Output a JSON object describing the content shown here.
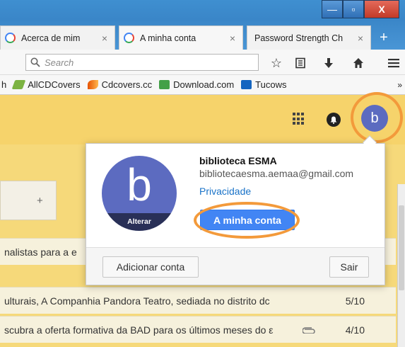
{
  "browser": {
    "tabs": [
      {
        "label": "Acerca de mim",
        "close": "×"
      },
      {
        "label": "A minha conta",
        "close": "×"
      },
      {
        "label": "Password Strength Ch",
        "close": "×"
      }
    ],
    "new_tab": "+",
    "window_buttons": {
      "minimize": "—",
      "maximize": "▫",
      "close": "X"
    },
    "search": {
      "placeholder": "Search"
    },
    "bookmarks": [
      {
        "label": "h"
      },
      {
        "label": "AllCDCovers",
        "color": "#7cb342"
      },
      {
        "label": "Cdcovers.cc",
        "color": "#e65100"
      },
      {
        "label": "Download.com",
        "color": "#2e7d32"
      },
      {
        "label": "Tucows",
        "color": "#1565c0"
      }
    ],
    "bookmarks_overflow": "»"
  },
  "gmail": {
    "avatar_letter": "b",
    "emails": [
      {
        "text": "nalistas para a e",
        "date": ""
      },
      {
        "text": "ulturais, A Companhia Pandora Teatro, sediada no distrito dc",
        "date": "5/10"
      },
      {
        "text": "scubra a oferta formativa da BAD para os últimos meses do ε",
        "date": "4/10",
        "attachment": true
      }
    ],
    "add_tab": "+"
  },
  "account_popup": {
    "avatar_letter": "b",
    "change_photo": "Alterar",
    "name": "biblioteca ESMA",
    "email": "bibliotecaesma.aemaa@gmail.com",
    "privacy": "Privacidade",
    "my_account_button": "A minha conta",
    "add_account": "Adicionar conta",
    "sign_out": "Sair"
  },
  "colors": {
    "highlight_ring": "#f39a3b",
    "header": "#f6d36b",
    "avatar": "#5c6bc0",
    "primary_button": "#4285f4"
  }
}
